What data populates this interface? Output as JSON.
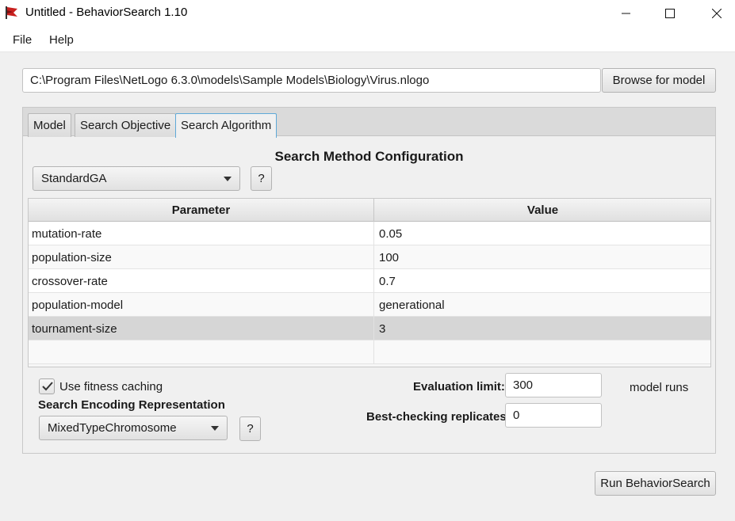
{
  "window": {
    "title": "Untitled - BehaviorSearch 1.10",
    "icon": "behaviorsearch-red-flag-icon",
    "controls": [
      "minimize-icon",
      "maximize-icon",
      "close-icon"
    ]
  },
  "menu": {
    "file": "File",
    "help": "Help"
  },
  "model": {
    "path": "C:\\Program Files\\NetLogo 6.3.0\\models\\Sample Models\\Biology\\Virus.nlogo",
    "browse_label": "Browse for model"
  },
  "tabs": [
    {
      "label": "Model",
      "active": false
    },
    {
      "label": "Search Objective",
      "active": false
    },
    {
      "label": "Search Algorithm",
      "active": true
    }
  ],
  "search_method": {
    "title": "Search Method Configuration",
    "selected": "StandardGA",
    "help_label": "?"
  },
  "param_table": {
    "headers": [
      "Parameter",
      "Value"
    ],
    "rows": [
      {
        "parameter": "mutation-rate",
        "value": "0.05"
      },
      {
        "parameter": "population-size",
        "value": "100"
      },
      {
        "parameter": "crossover-rate",
        "value": "0.7"
      },
      {
        "parameter": "population-model",
        "value": "generational"
      },
      {
        "parameter": "tournament-size",
        "value": "3",
        "selected": true
      }
    ]
  },
  "options": {
    "fitness_caching_label": "Use fitness caching",
    "fitness_caching_checked": true,
    "encoding_title": "Search Encoding Representation",
    "encoding_selected": "MixedTypeChromosome",
    "encoding_help_label": "?",
    "evaluation_limit_label": "Evaluation limit:",
    "evaluation_limit_value": "300",
    "evaluation_limit_unit": "model runs",
    "replicates_label": "Best-checking replicates:",
    "replicates_value": "0"
  },
  "run_label": "Run BehaviorSearch",
  "colors": {
    "active_tab_border": "#5fa9d8",
    "selected_row": "#d6d6d6",
    "icon_red": "#c8201e"
  }
}
